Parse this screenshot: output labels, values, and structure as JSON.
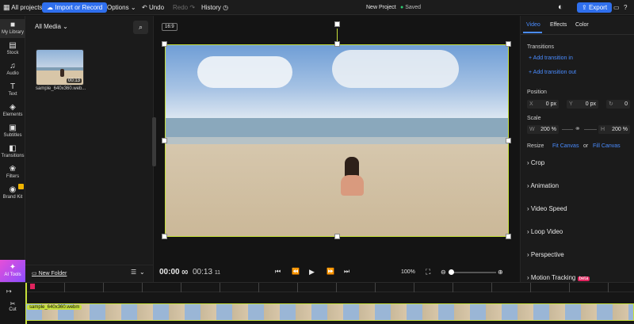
{
  "topbar": {
    "all_projects": "All projects",
    "import_label": "Import or Record",
    "options_label": "Options",
    "undo_label": "Undo",
    "redo_label": "Redo",
    "history_label": "History",
    "project_name": "New Project",
    "saved_label": "Saved",
    "export_label": "Export"
  },
  "rail": {
    "items": [
      {
        "label": "My Library",
        "icon": "folder-icon"
      },
      {
        "label": "Stock",
        "icon": "stock-icon"
      },
      {
        "label": "Audio",
        "icon": "music-icon"
      },
      {
        "label": "Text",
        "icon": "text-icon"
      },
      {
        "label": "Elements",
        "icon": "shapes-icon"
      },
      {
        "label": "Subtitles",
        "icon": "subtitles-icon"
      },
      {
        "label": "Transitions",
        "icon": "transitions-icon"
      },
      {
        "label": "Filters",
        "icon": "filters-icon"
      },
      {
        "label": "Brand Kit",
        "icon": "brand-icon"
      }
    ],
    "ai_tools": "AI Tools"
  },
  "library": {
    "filter_label": "All Media",
    "media": [
      {
        "name": "sample_640x360.web...",
        "duration": "00:13"
      }
    ],
    "new_folder": "New Folder"
  },
  "canvas": {
    "aspect_ratio": "16:9",
    "current_time": "00:00",
    "current_frames": "00",
    "total_time": "00:13",
    "total_frames": "11",
    "zoom": "100%"
  },
  "rightpanel": {
    "tabs": [
      "Video",
      "Effects",
      "Color"
    ],
    "transitions_title": "Transitions",
    "add_transition_in": "+ Add transition in",
    "add_transition_out": "+ Add transition out",
    "position_title": "Position",
    "pos_x_label": "X",
    "pos_x_value": "0 px",
    "pos_y_label": "Y",
    "pos_y_value": "0 px",
    "rotation_value": "0",
    "scale_title": "Scale",
    "scale_w_label": "W",
    "scale_w_value": "200 %",
    "scale_h_label": "H",
    "scale_h_value": "200 %",
    "resize_label": "Resize",
    "fit_canvas": "Fit Canvas",
    "or_label": "or",
    "fill_canvas": "Fill Canvas",
    "sections": [
      "Crop",
      "Animation",
      "Video Speed",
      "Loop Video",
      "Perspective",
      "Motion Tracking"
    ],
    "beta_label": "beta"
  },
  "timeline": {
    "cut_label": "Cut",
    "clip_label": "sample_640x360.webm"
  },
  "colors": {
    "accent": "#2f6fed",
    "selection": "#c6e03a",
    "link": "#4a8cff",
    "beta": "#e0245e",
    "ai": "#e64fd8"
  }
}
